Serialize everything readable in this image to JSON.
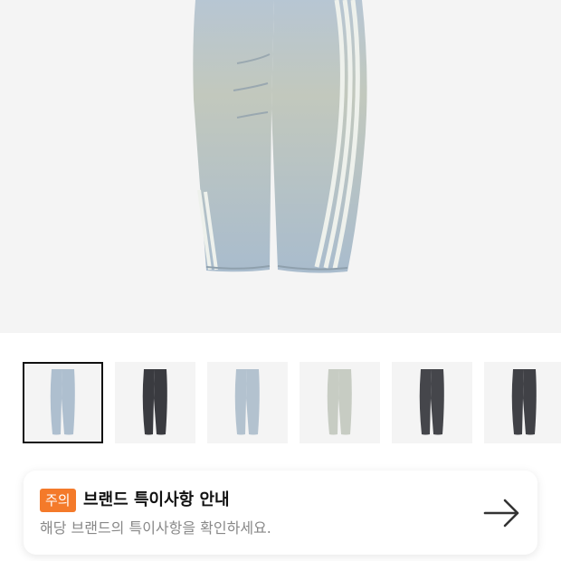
{
  "product": {
    "main_image": "light-wash-striped-barrel-jeans",
    "thumbnails": [
      {
        "image": "light-wash-jeans-front",
        "wash": "#aebfcf",
        "selected": true
      },
      {
        "image": "black-jeans-side",
        "wash": "#3a3b40",
        "selected": false
      },
      {
        "image": "light-wash-jeans-side",
        "wash": "#b3c2cf",
        "selected": false
      },
      {
        "image": "light-wash-jeans-back",
        "wash": "#c7ccc3",
        "selected": false
      },
      {
        "image": "black-jeans-front",
        "wash": "#45464b",
        "selected": false
      },
      {
        "image": "black-jeans-back",
        "wash": "#404146",
        "selected": false
      }
    ]
  },
  "notice": {
    "badge": "주의",
    "title": "브랜드 특이사항 안내",
    "description": "해당 브랜드의 특이사항을 확인하세요.",
    "arrow_icon": "arrow-right-icon"
  },
  "colors": {
    "badge": "#f47a2a",
    "selected_border": "#111111",
    "image_bg": "#f4f4f4"
  }
}
